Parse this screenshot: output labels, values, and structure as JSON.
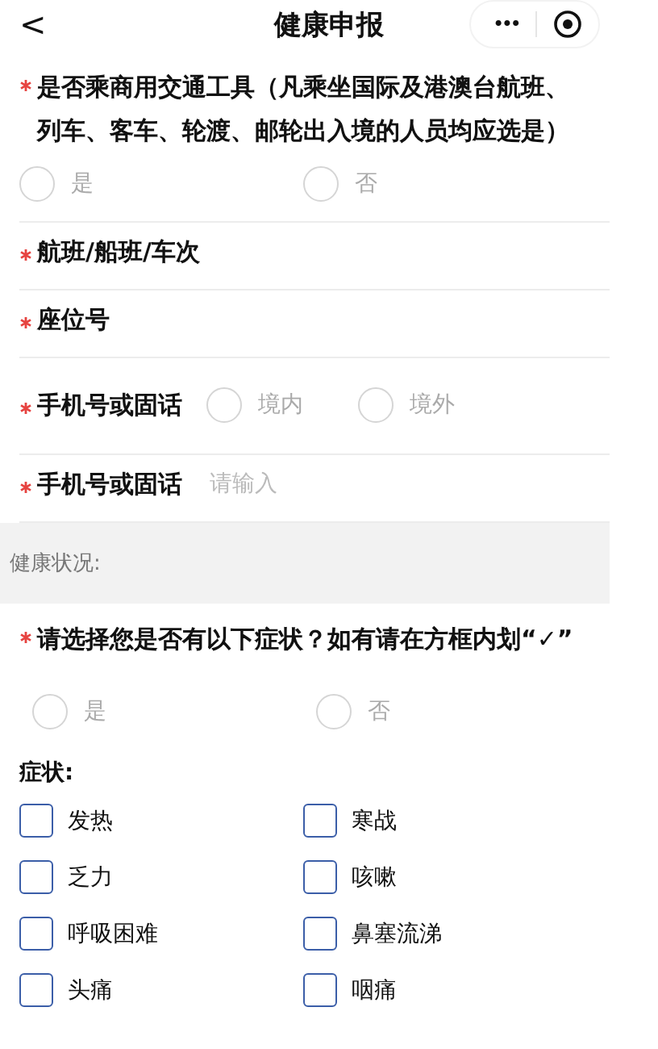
{
  "nav": {
    "back": "<",
    "title": "健康申报",
    "more": "•••"
  },
  "transport": {
    "label": "是否乘商用交通工具（凡乘坐国际及港澳台航班、列车、客车、轮渡、邮轮出入境的人员均应选是）",
    "required": true,
    "options": [
      {
        "label": "是",
        "selected": false
      },
      {
        "label": "否",
        "selected": false
      }
    ]
  },
  "fields": [
    {
      "kind": "text",
      "label": "航班/船班/车次",
      "required": true
    },
    {
      "kind": "text",
      "label": "座位号",
      "required": true
    },
    {
      "kind": "radio",
      "label": "手机号或固话",
      "required": true,
      "options": [
        {
          "label": "境内",
          "selected": false
        },
        {
          "label": "境外",
          "selected": false
        }
      ]
    },
    {
      "kind": "input",
      "label": "手机号或固话",
      "required": true,
      "placeholder": "请输入"
    }
  ],
  "section": {
    "title": "健康状况:"
  },
  "symptom_question": {
    "label": "请选择您是否有以下症状？如有请在方框内划“✓”",
    "required": true,
    "options": [
      {
        "label": "是",
        "selected": false
      },
      {
        "label": "否",
        "selected": false
      }
    ]
  },
  "symptoms": {
    "title": "症状:",
    "items": [
      {
        "label": "发热",
        "checked": false
      },
      {
        "label": "寒战",
        "checked": false
      },
      {
        "label": "乏力",
        "checked": false
      },
      {
        "label": "咳嗽",
        "checked": false
      },
      {
        "label": "呼吸困难",
        "checked": false
      },
      {
        "label": "鼻塞流涕",
        "checked": false
      },
      {
        "label": "头痛",
        "checked": false
      },
      {
        "label": "咽痛",
        "checked": false
      }
    ]
  }
}
